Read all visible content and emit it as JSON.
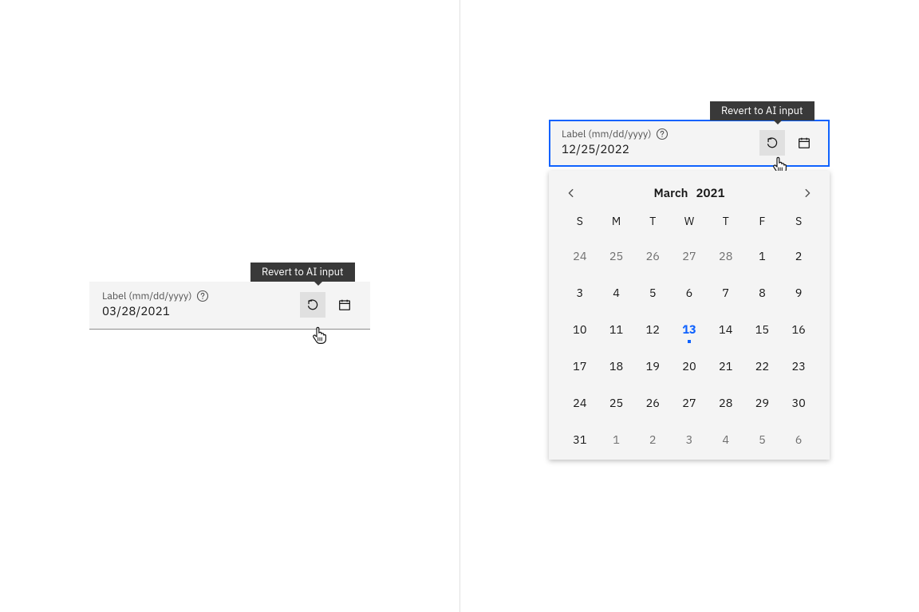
{
  "tooltip_text": "Revert to AI input",
  "left": {
    "label": "Label (mm/dd/yyyy)",
    "value": "03/28/2021"
  },
  "right": {
    "label": "Label (mm/dd/yyyy)",
    "value": "12/25/2022",
    "calendar": {
      "month": "March",
      "year": "2021",
      "weekdays": [
        "S",
        "M",
        "T",
        "W",
        "T",
        "F",
        "S"
      ],
      "days": [
        {
          "d": "24",
          "dim": true
        },
        {
          "d": "25",
          "dim": true
        },
        {
          "d": "26",
          "dim": true
        },
        {
          "d": "27",
          "dim": true
        },
        {
          "d": "28",
          "dim": true
        },
        {
          "d": "1"
        },
        {
          "d": "2"
        },
        {
          "d": "3"
        },
        {
          "d": "4"
        },
        {
          "d": "5"
        },
        {
          "d": "6"
        },
        {
          "d": "7"
        },
        {
          "d": "8"
        },
        {
          "d": "9"
        },
        {
          "d": "10"
        },
        {
          "d": "11"
        },
        {
          "d": "12"
        },
        {
          "d": "13",
          "today": true
        },
        {
          "d": "14"
        },
        {
          "d": "15"
        },
        {
          "d": "16"
        },
        {
          "d": "17"
        },
        {
          "d": "18"
        },
        {
          "d": "19"
        },
        {
          "d": "20"
        },
        {
          "d": "21"
        },
        {
          "d": "22"
        },
        {
          "d": "23"
        },
        {
          "d": "24"
        },
        {
          "d": "25"
        },
        {
          "d": "26"
        },
        {
          "d": "27"
        },
        {
          "d": "28"
        },
        {
          "d": "29"
        },
        {
          "d": "30"
        },
        {
          "d": "31"
        },
        {
          "d": "1",
          "dim": true
        },
        {
          "d": "2",
          "dim": true
        },
        {
          "d": "3",
          "dim": true
        },
        {
          "d": "4",
          "dim": true
        },
        {
          "d": "5",
          "dim": true
        },
        {
          "d": "6",
          "dim": true
        }
      ]
    }
  }
}
